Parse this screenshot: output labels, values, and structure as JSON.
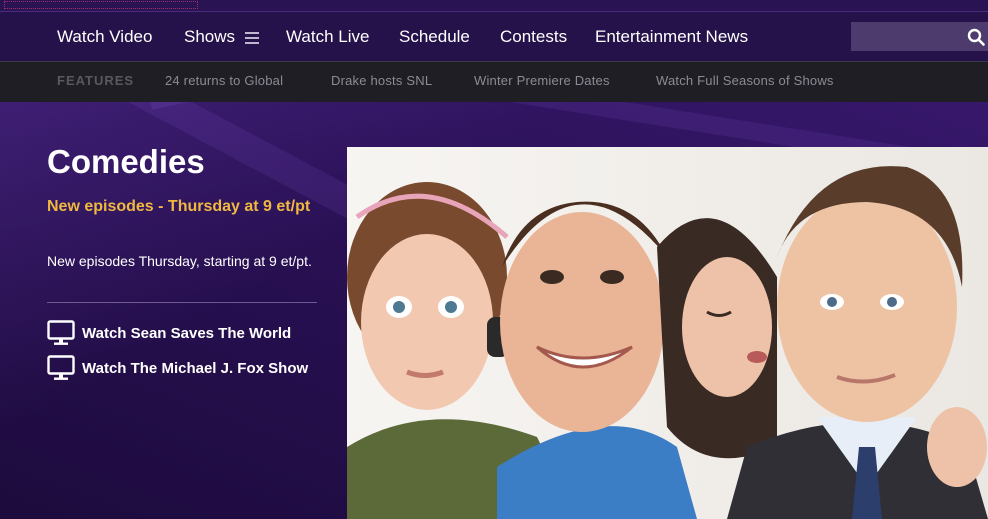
{
  "nav": {
    "items": [
      "Watch Video",
      "Shows",
      "Watch Live",
      "Schedule",
      "Contests",
      "Entertainment News"
    ],
    "shows_menu_icon": "hamburger-icon",
    "search_icon": "search-icon",
    "search_placeholder": ""
  },
  "subnav": {
    "label": "FEATURES",
    "items": [
      "24 returns to Global",
      "Drake hosts SNL",
      "Winter Premiere Dates",
      "Watch Full Seasons of Shows"
    ]
  },
  "main": {
    "title": "Comedies",
    "tagline": "New episodes - Thursday at 9 et/pt",
    "description": "New episodes Thursday, starting at 9 et/pt.",
    "links": [
      {
        "label": "Watch Sean Saves The World",
        "icon": "tv-icon"
      },
      {
        "label": "Watch The Michael J. Fox Show",
        "icon": "tv-icon"
      }
    ]
  },
  "colors": {
    "accent": "#f0b840",
    "nav_bg": "#26124a",
    "subnav_bg": "#1e1e24",
    "page_bg": "#2a1250"
  }
}
